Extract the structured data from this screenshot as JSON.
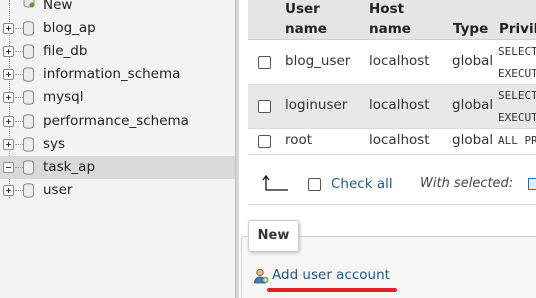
{
  "nav": {
    "new_label": "New",
    "databases": [
      {
        "name": "blog_ap",
        "expanded": false
      },
      {
        "name": "file_db",
        "expanded": false
      },
      {
        "name": "information_schema",
        "expanded": false
      },
      {
        "name": "mysql",
        "expanded": false
      },
      {
        "name": "performance_schema",
        "expanded": false
      },
      {
        "name": "sys",
        "expanded": false
      },
      {
        "name": "task_ap",
        "expanded": true,
        "selected": true
      },
      {
        "name": "user",
        "expanded": false
      }
    ]
  },
  "table": {
    "headers": {
      "user_line1": "User",
      "user_line2": "name",
      "host_line1": "Host",
      "host_line2": "name",
      "type": "Type",
      "privileges": "Privile"
    },
    "rows": [
      {
        "user": "blog_user",
        "host": "localhost",
        "type": "global",
        "priv_line1": "SELECT",
        "priv_line2": "EXECUT"
      },
      {
        "user": "loginuser",
        "host": "localhost",
        "type": "global",
        "priv_line1": "SELECT",
        "priv_line2": "EXECUT"
      },
      {
        "user": "root",
        "host": "localhost",
        "type": "global",
        "priv_line1": "ALL PR",
        "priv_line2": ""
      }
    ]
  },
  "tools": {
    "check_all": "Check all",
    "with_selected": "With selected:"
  },
  "new_section": {
    "legend": "New",
    "add_user": "Add user account"
  },
  "colors": {
    "link": "#235a81",
    "highlight_underline": "#e0202a",
    "selected_row": "#d9d9d9"
  }
}
